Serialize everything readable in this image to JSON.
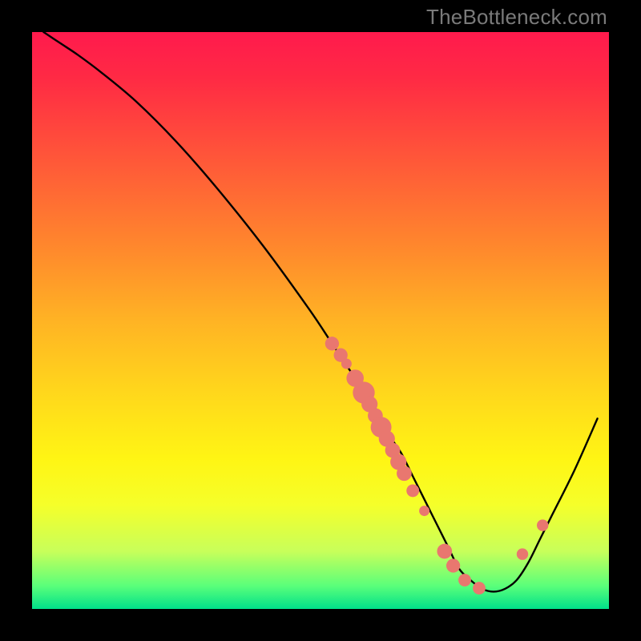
{
  "watermark": "TheBottleneck.com",
  "colors": {
    "background": "#000000",
    "marker": "#e9776f",
    "curve": "#000000"
  },
  "chart_data": {
    "type": "line",
    "title": "",
    "xlabel": "",
    "ylabel": "",
    "xlim": [
      0,
      100
    ],
    "ylim": [
      0,
      100
    ],
    "grid": false,
    "legend": false,
    "note": "Axes are implied (no tick labels rendered). x is horizontal position 0–100 left→right, y is vertical value 0–100 bottom→top. Curve descends steeply from top-left, bottoms out near x≈74, rises toward right.",
    "series": [
      {
        "name": "curve",
        "x": [
          2,
          5,
          8,
          12,
          18,
          25,
          32,
          40,
          48,
          52,
          54,
          56,
          58,
          60,
          62,
          64,
          66,
          68,
          70,
          72,
          74,
          76,
          78,
          80,
          82,
          84,
          86,
          88,
          90,
          94,
          98
        ],
        "y": [
          100,
          98,
          96,
          93,
          88,
          81,
          73,
          63,
          52,
          46,
          43,
          40,
          37,
          34,
          30,
          27,
          23,
          19,
          15,
          11,
          7,
          5,
          3.5,
          3,
          3.5,
          5,
          8,
          12,
          16,
          24,
          33
        ]
      }
    ],
    "markers": {
      "name": "scatter-points",
      "note": "Clustered points along the descending limb (~x 52–64), a few at the trough (~x 72–78), and two on the ascending limb (~x 85, 89).",
      "points": [
        {
          "x": 52.0,
          "y": 46.0,
          "r": 1.2
        },
        {
          "x": 53.5,
          "y": 44.0,
          "r": 1.2
        },
        {
          "x": 54.5,
          "y": 42.5,
          "r": 0.9
        },
        {
          "x": 56.0,
          "y": 40.0,
          "r": 1.5
        },
        {
          "x": 57.5,
          "y": 37.5,
          "r": 1.9
        },
        {
          "x": 58.5,
          "y": 35.5,
          "r": 1.4
        },
        {
          "x": 59.5,
          "y": 33.5,
          "r": 1.3
        },
        {
          "x": 60.5,
          "y": 31.5,
          "r": 1.8
        },
        {
          "x": 61.5,
          "y": 29.5,
          "r": 1.4
        },
        {
          "x": 62.5,
          "y": 27.5,
          "r": 1.3
        },
        {
          "x": 63.5,
          "y": 25.5,
          "r": 1.4
        },
        {
          "x": 64.5,
          "y": 23.5,
          "r": 1.3
        },
        {
          "x": 66.0,
          "y": 20.5,
          "r": 1.1
        },
        {
          "x": 68.0,
          "y": 17.0,
          "r": 0.9
        },
        {
          "x": 71.5,
          "y": 10.0,
          "r": 1.3
        },
        {
          "x": 73.0,
          "y": 7.5,
          "r": 1.2
        },
        {
          "x": 75.0,
          "y": 5.0,
          "r": 1.1
        },
        {
          "x": 77.5,
          "y": 3.6,
          "r": 1.1
        },
        {
          "x": 85.0,
          "y": 9.5,
          "r": 1.0
        },
        {
          "x": 88.5,
          "y": 14.5,
          "r": 1.0
        }
      ]
    }
  }
}
